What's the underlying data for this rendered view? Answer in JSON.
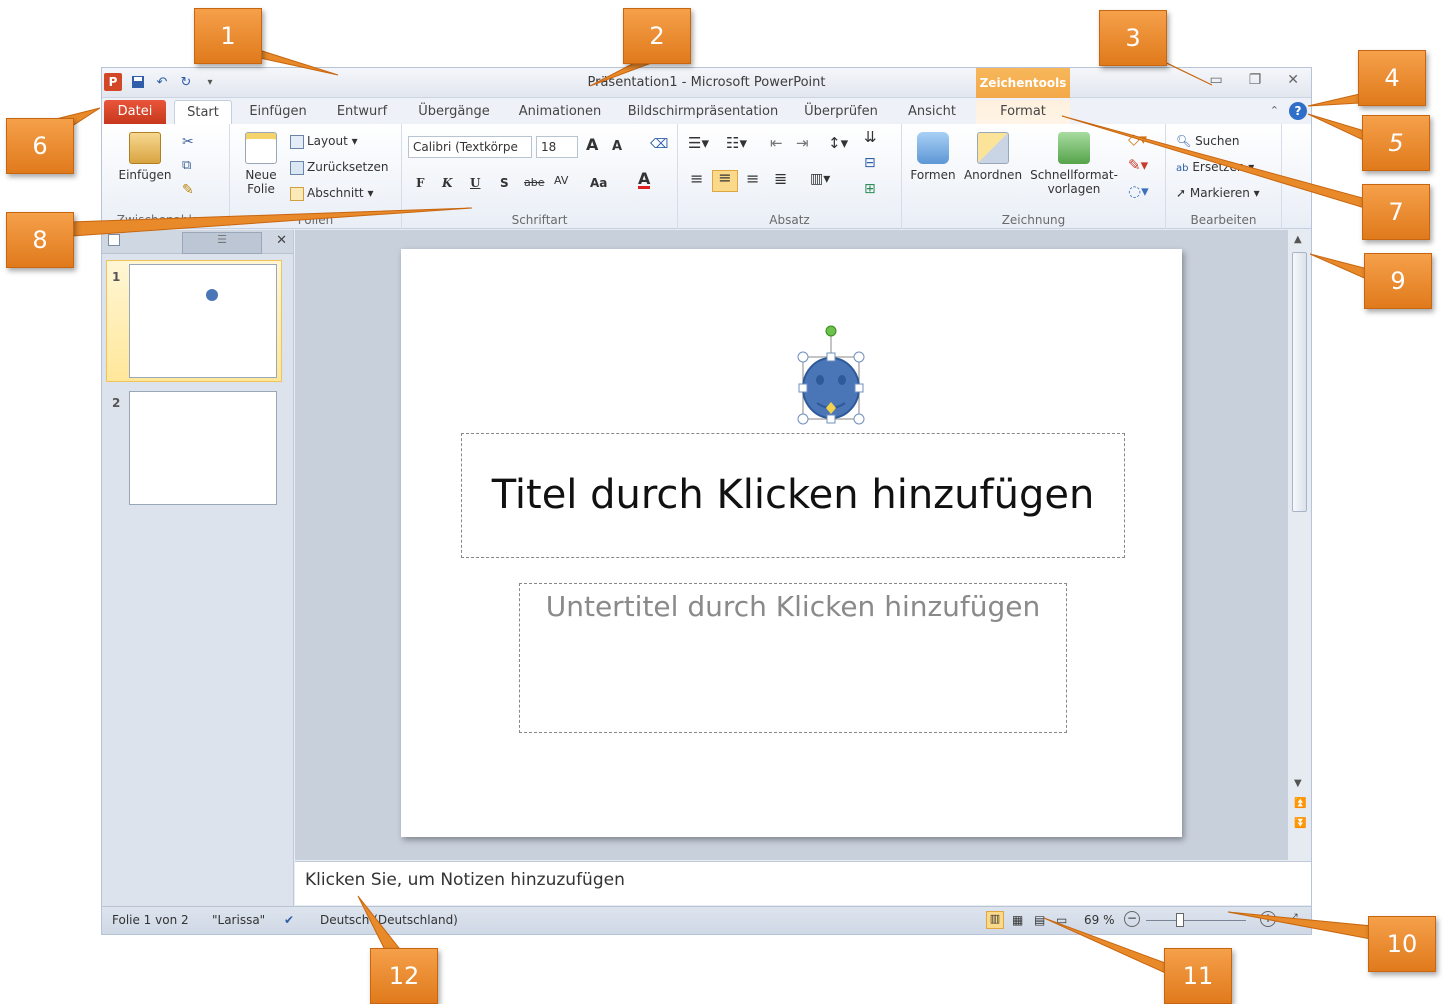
{
  "window": {
    "title": "Präsentation1 - Microsoft PowerPoint",
    "app_icon": "P",
    "context_tab_group": "Zeichentools"
  },
  "tabs": [
    "Datei",
    "Start",
    "Einfügen",
    "Entwurf",
    "Übergänge",
    "Animationen",
    "Bildschirmpräsentation",
    "Überprüfen",
    "Ansicht",
    "Format"
  ],
  "ribbon": {
    "clipboard": {
      "paste": "Einfügen",
      "label": "Zwischenablage"
    },
    "slides": {
      "new_slide_1": "Neue",
      "new_slide_2": "Folie",
      "layout": "Layout",
      "reset": "Zurücksetzen",
      "section": "Abschnitt",
      "label": "Folien"
    },
    "font": {
      "family": "Calibri (Textkörpe",
      "size": "18",
      "bold": "F",
      "italic": "K",
      "underline": "U",
      "shadow": "S",
      "strike": "abe",
      "spacing": "AV",
      "case": "Aa",
      "color": "A",
      "grow": "A",
      "shrink": "A",
      "label": "Schriftart"
    },
    "paragraph": {
      "label": "Absatz"
    },
    "drawing": {
      "shapes": "Formen",
      "arrange": "Anordnen",
      "quick_styles_1": "Schnellformat-",
      "quick_styles_2": "vorlagen",
      "label": "Zeichnung"
    },
    "editing": {
      "find": "Suchen",
      "replace": "Ersetzen",
      "select": "Markieren",
      "label": "Bearbeiten"
    }
  },
  "slides_panel": {
    "slide_numbers": [
      "1",
      "2"
    ]
  },
  "slide": {
    "title_placeholder": "Titel durch Klicken hinzufügen",
    "subtitle_placeholder": "Untertitel durch Klicken hinzufügen"
  },
  "notes": {
    "placeholder": "Klicken Sie, um Notizen hinzuzufügen"
  },
  "status": {
    "slide_info": "Folie 1 von 2",
    "theme": "\"Larissa\"",
    "language": "Deutsch (Deutschland)",
    "zoom": "69 %"
  },
  "callouts": [
    "1",
    "2",
    "3",
    "4",
    "5",
    "6",
    "7",
    "8",
    "9",
    "10",
    "11",
    "12"
  ],
  "colors": {
    "accent": "#e07a1c",
    "file_tab": "#d24726",
    "context": "#f3a94a",
    "smiley": "#4a76b8"
  }
}
